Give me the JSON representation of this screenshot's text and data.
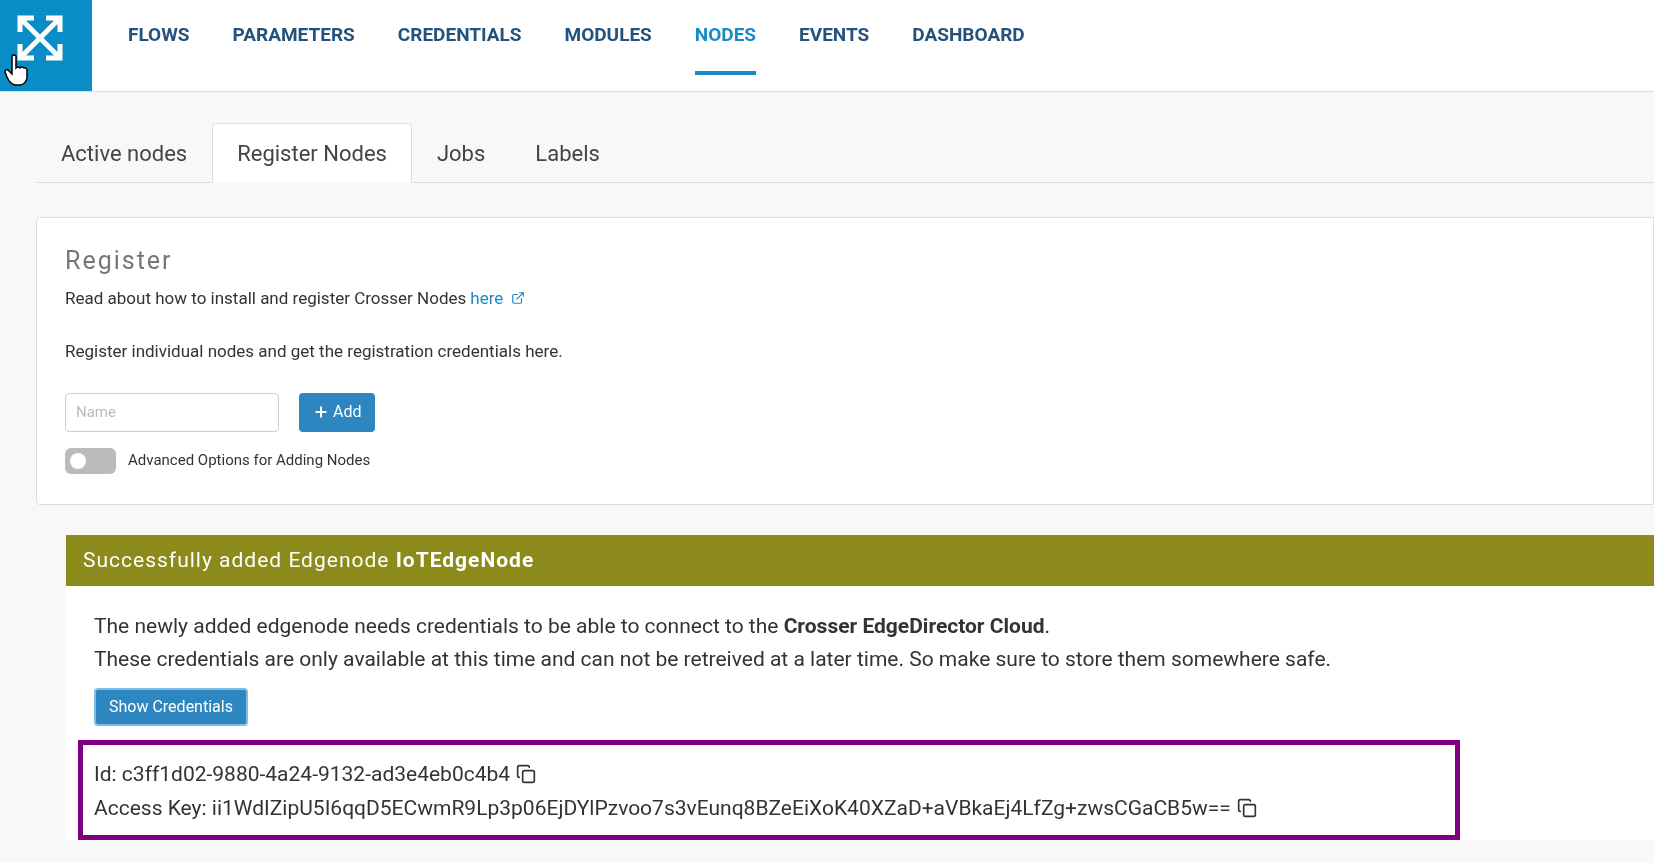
{
  "nav": {
    "items": [
      {
        "label": "FLOWS",
        "selected": false
      },
      {
        "label": "PARAMETERS",
        "selected": false
      },
      {
        "label": "CREDENTIALS",
        "selected": false
      },
      {
        "label": "MODULES",
        "selected": false
      },
      {
        "label": "NODES",
        "selected": true
      },
      {
        "label": "EVENTS",
        "selected": false
      },
      {
        "label": "DASHBOARD",
        "selected": false
      }
    ]
  },
  "tabs": [
    {
      "label": "Active nodes",
      "selected": false
    },
    {
      "label": "Register Nodes",
      "selected": true
    },
    {
      "label": "Jobs",
      "selected": false
    },
    {
      "label": "Labels",
      "selected": false
    }
  ],
  "register": {
    "title": "Register",
    "intro": "Read about how to install and register Crosser Nodes",
    "intro_link": "here",
    "description": "Register individual nodes and get the registration credentials here.",
    "name_field": {
      "placeholder": "Name"
    },
    "add_button": "Add",
    "advanced_toggle": {
      "label": "Advanced Options for Adding Nodes",
      "on": false
    }
  },
  "success": {
    "title": "Successfully added Edgenode **IoTEdgeNode**",
    "lines": [
      "The newly added edgenode needs credentials to be able to connect to the **Crosser EdgeDirector Cloud**.",
      "These credentials are only available at this time and can not be retreived at a later time. So make sure to store them somewhere safe."
    ],
    "show_button": "Show Credentials",
    "credentials": [
      "Id: c3ff1d02-9880-4a24-9132-ad3e4eb0c4b4",
      "Access Key: ii1WdIZipU5I6qqD5ECwmR9Lp3p06EjDYlPzvoo7s3vEunq8BZeEiXoK40XZaD+aVBkaEj4LfZg+zwsCGaCB5w=="
    ]
  }
}
